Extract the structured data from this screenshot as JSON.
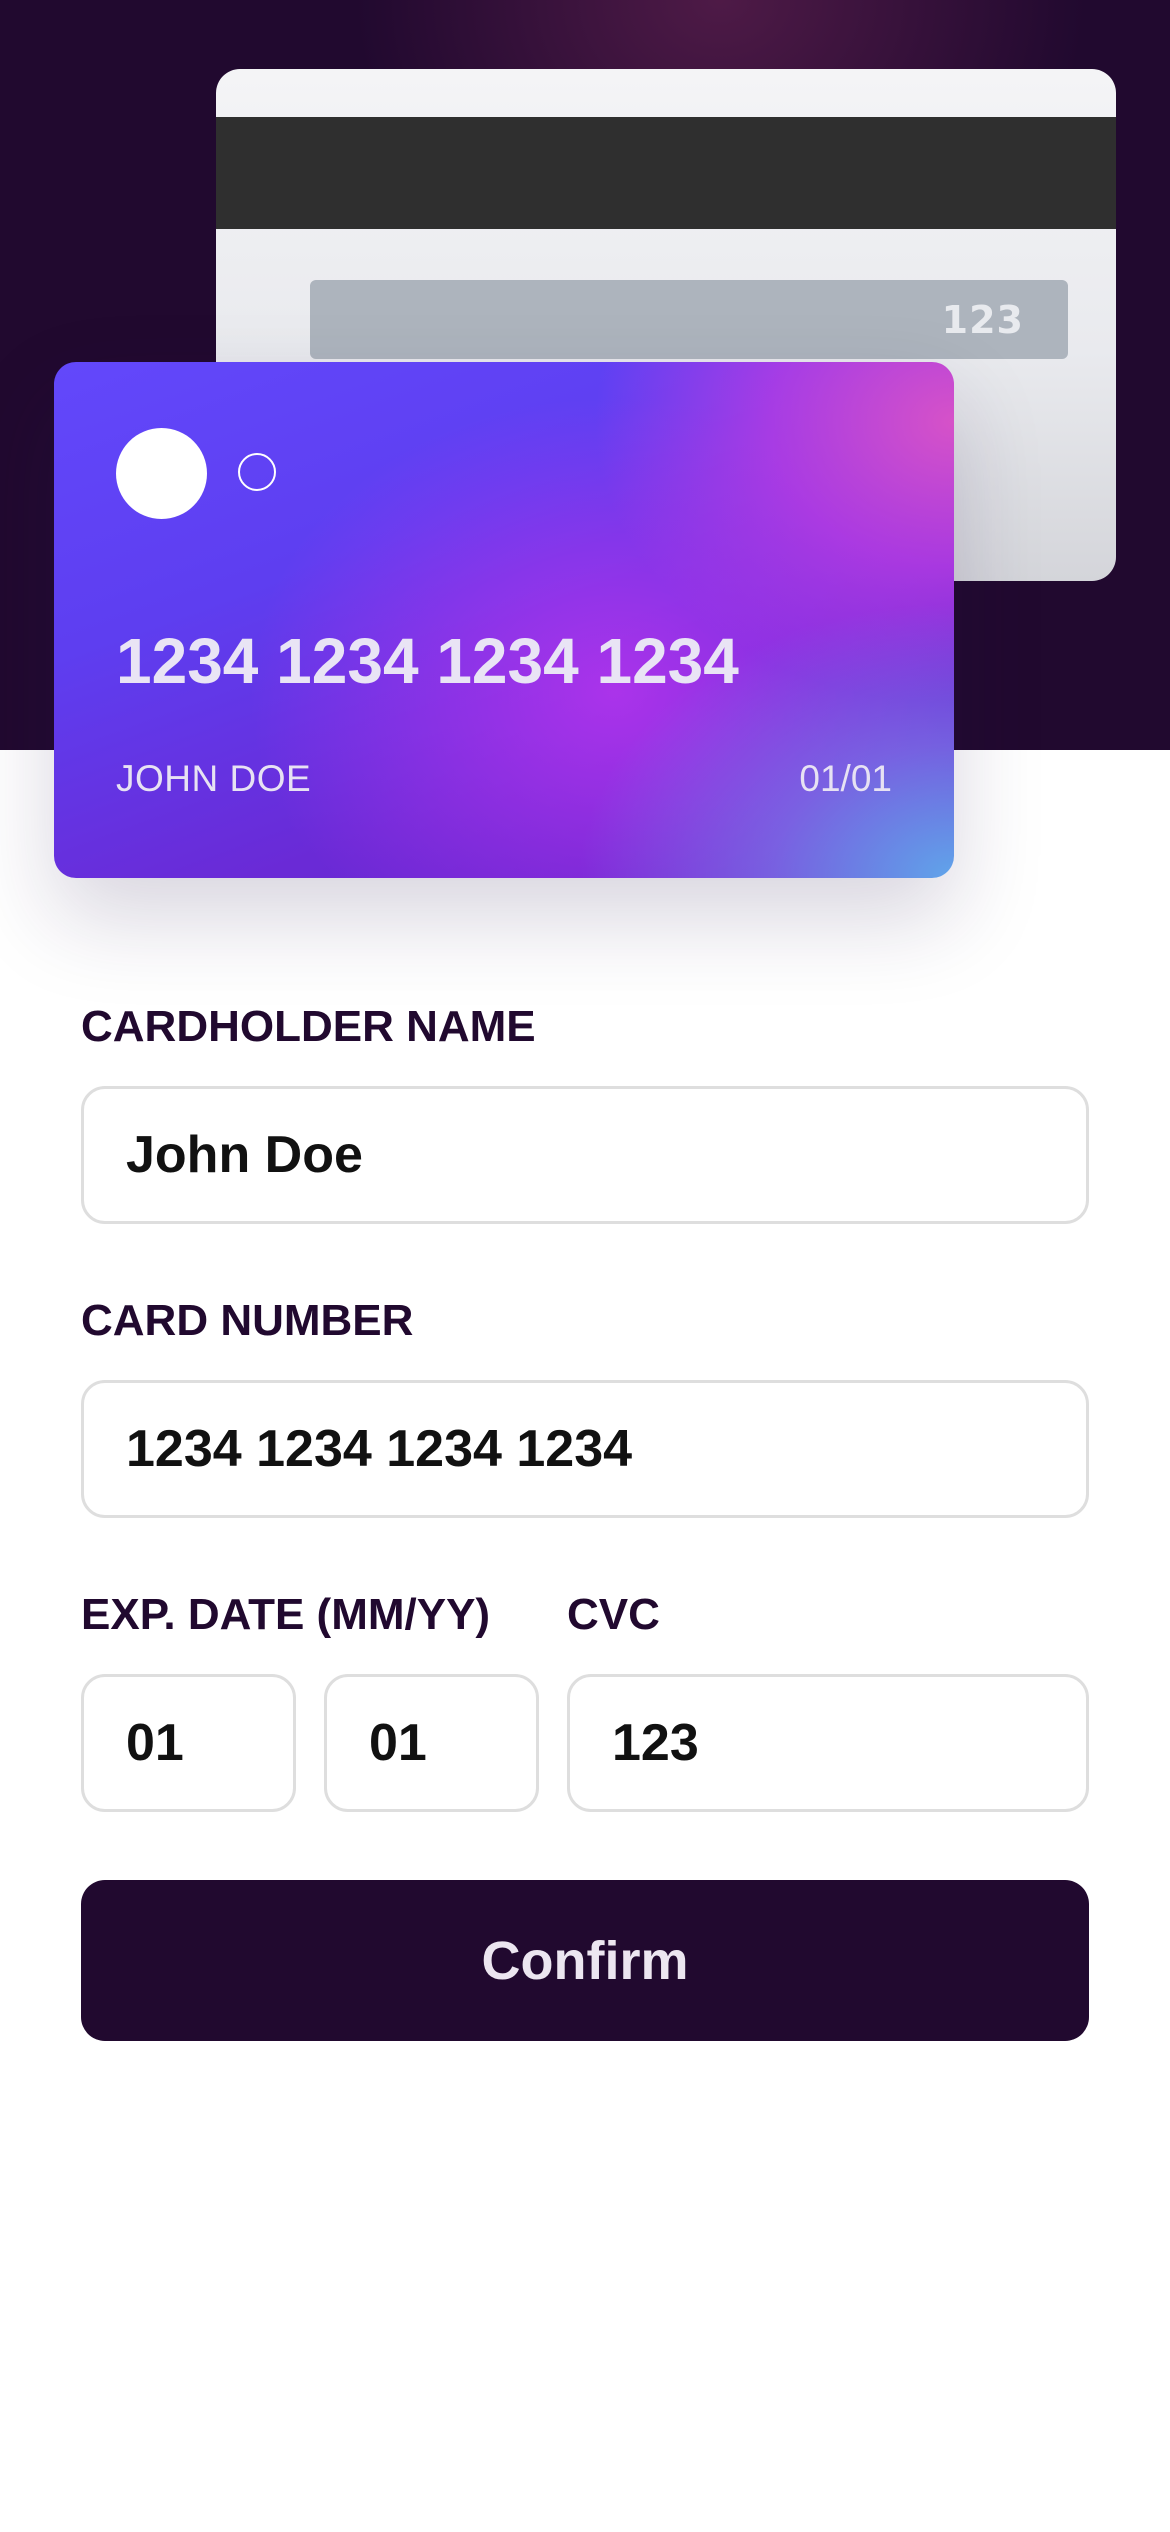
{
  "card_preview": {
    "back": {
      "cvc": "123"
    },
    "front": {
      "number": "1234 1234 1234 1234",
      "holder": "JOHN DOE",
      "expiry": "01/01"
    }
  },
  "form": {
    "cardholder_name": {
      "label": "CARDHOLDER NAME",
      "value": "John Doe"
    },
    "card_number": {
      "label": "CARD NUMBER",
      "value": "1234 1234 1234 1234"
    },
    "exp_date": {
      "label": "EXP. DATE (MM/YY)",
      "month": "01",
      "year": "01"
    },
    "cvc": {
      "label": "CVC",
      "value": "123"
    },
    "confirm_label": "Confirm"
  },
  "colors": {
    "dark": "#21092f",
    "card_gradient_start": "#6248fb",
    "card_gradient_end": "#60a5ea"
  }
}
